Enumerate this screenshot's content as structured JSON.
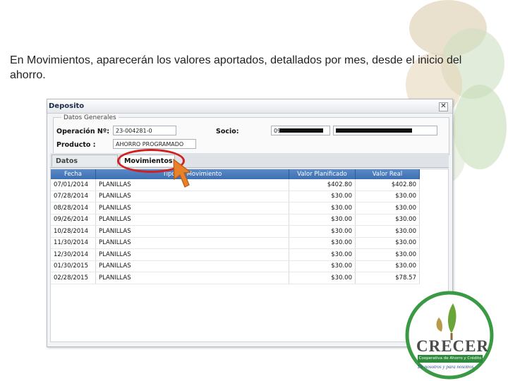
{
  "caption": "En Movimientos, aparecerán los valores aportados, detallados por mes, desde el inicio del ahorro.",
  "window": {
    "title": "Deposito",
    "close_glyph": "✕"
  },
  "general": {
    "legend": "Datos Generales",
    "operacion_label": "Operación Nº:",
    "operacion_value": "23-004281-0",
    "socio_label": "Socio:",
    "socio_value": "09",
    "producto_label": "Producto :",
    "producto_value": "AHORRO PROGRAMADO"
  },
  "tabs": [
    {
      "label": "Datos Generales"
    },
    {
      "label": "Movimientos"
    }
  ],
  "grid": {
    "headers": [
      "Fecha",
      "Tipo de Movimiento",
      "Valor Planificado",
      "Valor Real"
    ],
    "rows": [
      {
        "fecha": "07/01/2014",
        "tipo": "PLANILLAS",
        "planificado": "$402.80",
        "real": "$402.80"
      },
      {
        "fecha": "07/28/2014",
        "tipo": "PLANILLAS",
        "planificado": "$30.00",
        "real": "$30.00"
      },
      {
        "fecha": "08/28/2014",
        "tipo": "PLANILLAS",
        "planificado": "$30.00",
        "real": "$30.00"
      },
      {
        "fecha": "09/26/2014",
        "tipo": "PLANILLAS",
        "planificado": "$30.00",
        "real": "$30.00"
      },
      {
        "fecha": "10/28/2014",
        "tipo": "PLANILLAS",
        "planificado": "$30.00",
        "real": "$30.00"
      },
      {
        "fecha": "11/30/2014",
        "tipo": "PLANILLAS",
        "planificado": "$30.00",
        "real": "$30.00"
      },
      {
        "fecha": "12/30/2014",
        "tipo": "PLANILLAS",
        "planificado": "$30.00",
        "real": "$30.00"
      },
      {
        "fecha": "01/30/2015",
        "tipo": "PLANILLAS",
        "planificado": "$30.00",
        "real": "$30.00"
      },
      {
        "fecha": "02/28/2015",
        "tipo": "PLANILLAS",
        "planificado": "$30.00",
        "real": "$78.57"
      }
    ]
  },
  "logo": {
    "name": "CRECER",
    "subtitle": "Cooperativa de Ahorro y Crédito",
    "slogan": "De nosotros y para nosotros"
  },
  "colors": {
    "header_blue": "#3d6fb3",
    "highlight_red": "#d02020",
    "cursor_orange": "#e8822a",
    "brand_green": "#2e8a3a"
  },
  "icons": {
    "close": "close-icon",
    "cursor": "arrow-cursor-icon"
  }
}
